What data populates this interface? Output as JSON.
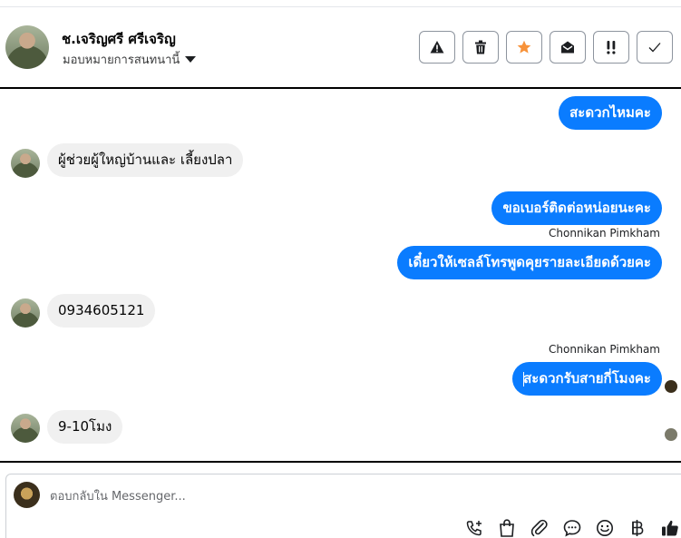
{
  "header": {
    "contact_name": "ช.เจริญศรี ศรีเจริญ",
    "assign_label": "มอบหมายการสนทนานี้",
    "actions": [
      {
        "name": "spam",
        "icon": "warning-icon"
      },
      {
        "name": "delete",
        "icon": "trash-icon"
      },
      {
        "name": "follow-up",
        "icon": "star-icon"
      },
      {
        "name": "mark-unread",
        "icon": "open-envelope-icon"
      },
      {
        "name": "priority",
        "icon": "double-exclamation-icon"
      },
      {
        "name": "done",
        "icon": "check-icon"
      }
    ]
  },
  "messages": [
    {
      "direction": "out",
      "text": "สะดวกไหมคะ"
    },
    {
      "direction": "in",
      "text": "ผู้ช่วยผู้ใหญ่บ้านและ เลี้ยงปลา"
    },
    {
      "direction": "out",
      "text": "ขอเบอร์ติดต่อหน่อยนะคะ"
    },
    {
      "direction": "out",
      "sender": "Chonnikan Pimkham",
      "text": "เดี๋ยวให้เซลล์โทรพูดคุยรายละเอียดด้วยคะ"
    },
    {
      "direction": "in",
      "text": "0934605121"
    },
    {
      "direction": "out",
      "sender": "Chonnikan Pimkham",
      "text": "สะดวกรับสายกี่โมงคะ"
    },
    {
      "direction": "in",
      "text": "9-10โมง"
    }
  ],
  "composer": {
    "placeholder": "ตอบกลับใน Messenger...",
    "tools": [
      "phone-plus-icon",
      "shopping-bag-icon",
      "paperclip-icon",
      "chat-bubble-icon",
      "smiley-icon",
      "baht-icon",
      "thumbs-up-icon"
    ]
  },
  "colors": {
    "outgoing_bubble": "#0a7cff",
    "incoming_bubble": "#f0f0f0",
    "star_accent": "#f7923a"
  }
}
